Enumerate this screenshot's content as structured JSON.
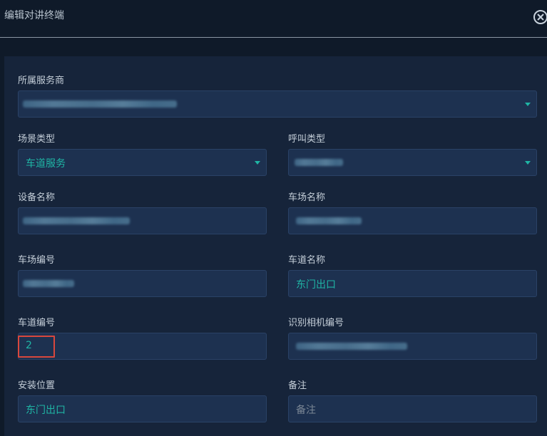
{
  "window": {
    "title": "编辑对讲终端"
  },
  "form": {
    "provider": {
      "label": "所属服务商"
    },
    "scene_type": {
      "label": "场景类型",
      "value": "车道服务"
    },
    "call_type": {
      "label": "呼叫类型"
    },
    "device_name": {
      "label": "设备名称"
    },
    "parking_lot_name": {
      "label": "车场名称"
    },
    "parking_lot_code": {
      "label": "车场编号"
    },
    "lane_name": {
      "label": "车道名称",
      "value": "东门出口"
    },
    "lane_code": {
      "label": "车道编号",
      "value": "2"
    },
    "camera_code": {
      "label": "识别相机编号"
    },
    "install_location": {
      "label": "安装位置",
      "value": "东门出口"
    },
    "remark": {
      "label": "备注",
      "placeholder": "备注"
    }
  },
  "colors": {
    "background": "#0f1a29",
    "panel": "#16243a",
    "field": "#1d3150",
    "accent_teal": "#1fb5a5",
    "highlight_red": "#d9473d"
  },
  "icons": {
    "close": "close-circle-icon",
    "dropdown": "caret-down-icon"
  }
}
